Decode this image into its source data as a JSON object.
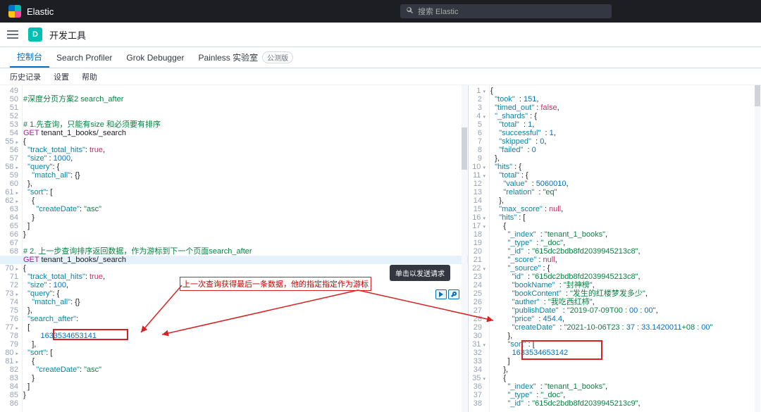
{
  "top": {
    "brand": "Elastic",
    "search_placeholder": "搜索 Elastic"
  },
  "nav": {
    "d": "D",
    "crumb": "开发工具"
  },
  "tabs": {
    "t0": "控制台",
    "t1": "Search Profiler",
    "t2": "Grok Debugger",
    "t3": "Painless 实验室",
    "badge": "公测版"
  },
  "subbar": {
    "a": "历史记录",
    "b": "设置",
    "c": "帮助"
  },
  "tooltip": "单击以发送请求",
  "callout": "上一次查询获得最后一条数据，他的指定指定作为游标",
  "left_lines_start": 49,
  "left_code": [
    "",
    "#深度分页方案2 search_after",
    "",
    "",
    "# 1.先查询，只能有size 和必须要有排序",
    "GET tenant_1_books/_search",
    "{",
    "  \"track_total_hits\": true,",
    "  \"size\" : 1000,",
    "  \"query\": {",
    "    \"match_all\": {}",
    "  },",
    "  \"sort\": [",
    "    {",
    "      \"createDate\": \"asc\"",
    "    }",
    "  ]",
    "}",
    "",
    "# 2. 上一步查询排序返回数据，作为游标到下一个页面search_after",
    "GET tenant_1_books/_search",
    "{",
    "  \"track_total_hits\": true,",
    "  \"size\" : 100,",
    "  \"query\": {",
    "    \"match_all\": {}",
    "  },",
    "  \"search_after\":",
    "  [",
    "        1633534653141",
    "    ],",
    "  \"sort\": [",
    "    {",
    "      \"createDate\": \"asc\"",
    "    }",
    "  ]",
    "}",
    ""
  ],
  "right_code": [
    "{",
    "  \"took\" : 151,",
    "  \"timed_out\" : false,",
    "  \"_shards\" : {",
    "    \"total\" : 1,",
    "    \"successful\" : 1,",
    "    \"skipped\" : 0,",
    "    \"failed\" : 0",
    "  },",
    "  \"hits\" : {",
    "    \"total\" : {",
    "      \"value\" : 5060010,",
    "      \"relation\" : \"eq\"",
    "    },",
    "    \"max_score\" : null,",
    "    \"hits\" : [",
    "      {",
    "        \"_index\" : \"tenant_1_books\",",
    "        \"_type\" : \"_doc\",",
    "        \"_id\" : \"615dc2bdb8fd2039945213c8\",",
    "        \"_score\" : null,",
    "        \"_source\" : {",
    "          \"id\" : \"615dc2bdb8fd2039945213c8\",",
    "          \"bookName\" : \"封神榜\",",
    "          \"bookContent\" : \"发生的红楼梦发多少\",",
    "          \"auther\" : \"我吃西红柿\",",
    "          \"publishDate\" : \"2019-07-09T00:00:00\",",
    "          \"price\" : 454.4,",
    "          \"createDate\" : \"2021-10-06T23:37:33.1420011+08:00\"",
    "        },",
    "        \"sort\" : [",
    "          1633534653142",
    "        ]",
    "      },",
    "      {",
    "        \"_index\" : \"tenant_1_books\",",
    "        \"_type\" : \"_doc\",",
    "        \"_id\" : \"615dc2bdb8fd2039945213c9\","
  ]
}
